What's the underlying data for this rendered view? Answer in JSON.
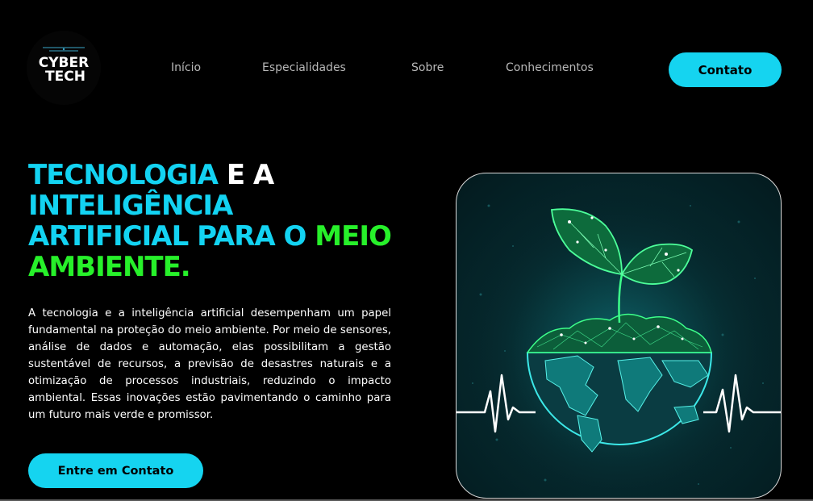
{
  "logo": {
    "line1": "CYBER",
    "line2": "TECH"
  },
  "nav": {
    "items": [
      {
        "label": "Início"
      },
      {
        "label": "Especialidades"
      },
      {
        "label": "Sobre"
      },
      {
        "label": "Conhecimentos"
      }
    ],
    "contact_label": "Contato"
  },
  "hero": {
    "title": {
      "part1": "TECNOLOGIA",
      "part2": "E A",
      "part3": "INTELIGÊNCIA ARTIFICIAL PARA O",
      "part4": "MEIO AMBIENTE."
    },
    "paragraph": "A tecnologia e a inteligência artificial desempenham um papel fundamental na proteção do meio ambiente. Por meio de sensores, análise de dados e automação, elas possibilitam a gestão sustentável de recursos, a previsão de desastres naturais e a otimização de processos industriais, reduzindo o impacto ambiental. Essas inovações estão pavimentando o caminho para um futuro mais verde e promissor.",
    "cta_label": "Entre em Contato"
  },
  "colors": {
    "accent_cyan": "#15d4f0",
    "accent_green": "#27f02a",
    "background": "#000000"
  },
  "illustration": {
    "icon": "digital-plant-globe-heartbeat"
  }
}
